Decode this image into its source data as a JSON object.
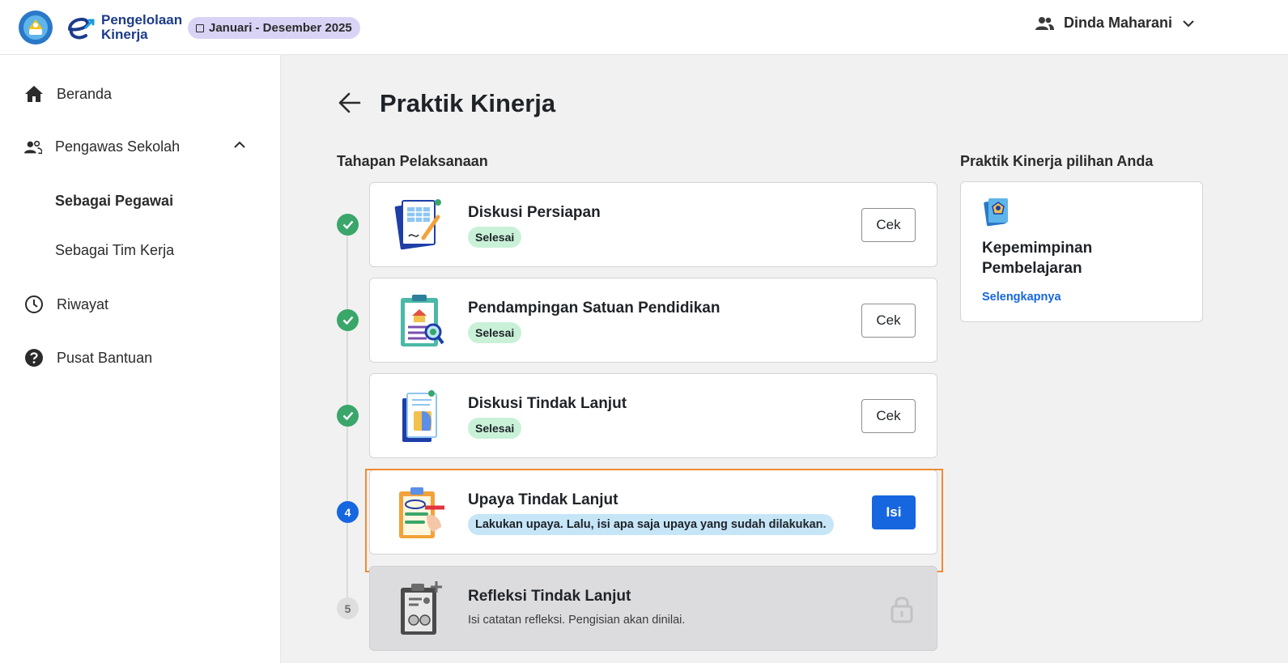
{
  "header": {
    "brand_line1": "Pengelolaan",
    "brand_line2": "Kinerja",
    "period": "Januari - Desember 2025",
    "user_name": "Dinda Maharani"
  },
  "sidebar": {
    "items": [
      {
        "label": "Beranda",
        "icon": "home-icon"
      },
      {
        "label": "Pengawas Sekolah",
        "icon": "people-icon"
      },
      {
        "label": "Sebagai Pegawai"
      },
      {
        "label": "Sebagai Tim Kerja"
      },
      {
        "label": "Riwayat",
        "icon": "clock-icon"
      },
      {
        "label": "Pusat Bantuan",
        "icon": "help-icon"
      }
    ]
  },
  "main": {
    "title": "Praktik Kinerja",
    "section_title": "Tahapan Pelaksanaan",
    "steps": [
      {
        "title": "Diskusi Persiapan",
        "status": "Selesai",
        "action": "Cek"
      },
      {
        "title": "Pendampingan Satuan Pendidikan",
        "status": "Selesai",
        "action": "Cek"
      },
      {
        "title": "Diskusi Tindak Lanjut",
        "status": "Selesai",
        "action": "Cek"
      },
      {
        "number": "4",
        "title": "Upaya Tindak Lanjut",
        "status": "Lakukan upaya. Lalu, isi apa saja upaya yang sudah dilakukan.",
        "action": "Isi"
      },
      {
        "number": "5",
        "title": "Refleksi Tindak Lanjut",
        "status": "Isi catatan refleksi. Pengisian akan dinilai."
      }
    ],
    "side_title": "Praktik Kinerja pilihan Anda",
    "choice": {
      "title": "Kepemimpinan Pembelajaran",
      "link": "Selengkapnya"
    }
  },
  "colors": {
    "primary": "#1666e0",
    "success": "#3aa66a",
    "success_bg": "#c9f1d8",
    "info_bg": "#c6e6f8",
    "highlight": "#f08a35",
    "period_chip_bg": "#d9d3f5"
  }
}
